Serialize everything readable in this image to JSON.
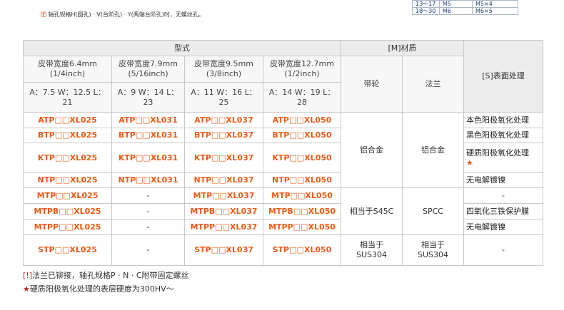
{
  "mini_table": [
    [
      "13～17",
      "M5",
      "M5×4"
    ],
    [
      "18～30",
      "M6",
      "M6×5"
    ]
  ],
  "top_note": {
    "icon": "Ⓣ",
    "text": "轴孔规格H(圆孔) · V(台阶孔) · Y(两端台阶孔)时，无螺纹孔。"
  },
  "header": {
    "type_label": "型式",
    "material_label": "[M]材质",
    "surface_label": "[S]表面处理",
    "pulley_label": "带轮",
    "flange_label": "法兰",
    "widths": [
      {
        "title": "皮带宽度6.4mm",
        "inch": "(1/4inch)",
        "dims": "A：7.5 W：12.5 L：21"
      },
      {
        "title": "皮带宽度7.9mm",
        "inch": "(5/16inch)",
        "dims": "A：9 W：14 L：23"
      },
      {
        "title": "皮带宽度9.5mm",
        "inch": "(3/8inch)",
        "dims": "A：11 W：16 L：25"
      },
      {
        "title": "皮带宽度12.7mm",
        "inch": "(1/2inch)",
        "dims": "A：14 W：19 L：28"
      }
    ]
  },
  "rows": [
    {
      "parts": [
        "ATP□□XL025",
        "ATP□□XL031",
        "ATP□□XL037",
        "ATP□□XL050"
      ],
      "surface": "本色阳极氧化处理"
    },
    {
      "parts": [
        "BTP□□XL025",
        "BTP□□XL031",
        "BTP□□XL037",
        "BTP□□XL050"
      ],
      "surface": "黑色阳极氧化处理"
    },
    {
      "parts": [
        "KTP□□XL025",
        "KTP□□XL031",
        "KTP□□XL037",
        "KTP□□XL050"
      ],
      "surface": "硬质阳极氧化处理",
      "surface_mark": "★"
    },
    {
      "parts": [
        "NTP□□XL025",
        "NTP□□XL031",
        "NTP□□XL037",
        "NTP□□XL050"
      ],
      "surface": "无电解镀镍"
    },
    {
      "parts": [
        "MTP□□XL025",
        "-",
        "MTP□□XL037",
        "MTP□□XL050"
      ],
      "surface": "-"
    },
    {
      "parts": [
        "MTPB□□XL025",
        "-",
        "MTPB□□XL037",
        "MTPB□□XL050"
      ],
      "surface": "四氧化三铁保护膜"
    },
    {
      "parts": [
        "MTPP□□XL025",
        "-",
        "MTPP□□XL037",
        "MTPP□□XL050"
      ],
      "surface": "无电解镀镍"
    },
    {
      "parts": [
        "STP□□XL025",
        "-",
        "STP□□XL037",
        "STP□□XL050"
      ],
      "surface": "-"
    }
  ],
  "materials": {
    "group1_pulley": "铝合金",
    "group1_flange": "铝合金",
    "group2_pulley": "相当于S45C",
    "group2_flange": "SPCC",
    "group3_pulley_a": "相当于",
    "group3_pulley_b": "SUS304",
    "group3_flange_a": "相当于",
    "group3_flange_b": "SUS304"
  },
  "footnotes": {
    "note1_mark": "[!]",
    "note1_text": "法兰已铆接，轴孔规格P · N · C附带固定螺丝",
    "note2_mark": "★",
    "note2_text": "硬质阳极氧化处理的表层硬度为300HV～"
  },
  "colors": {
    "part_number": "#f05a17",
    "header_bg": "#ececec",
    "border": "#c8c8c8"
  }
}
